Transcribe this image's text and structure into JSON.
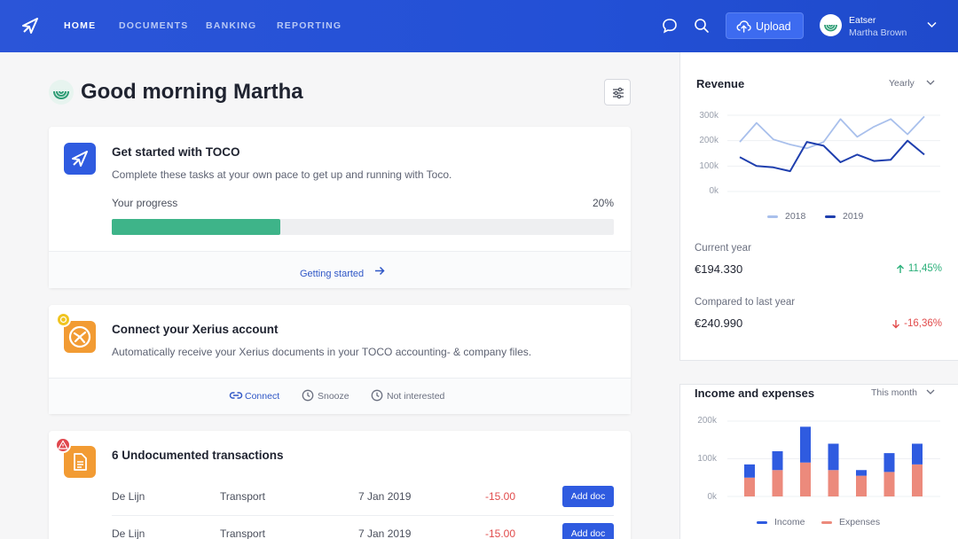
{
  "topbar": {
    "nav": [
      {
        "label": "HOME",
        "active": true
      },
      {
        "label": "DOCUMENTS",
        "active": false
      },
      {
        "label": "BANKING",
        "active": false
      },
      {
        "label": "REPORTING",
        "active": false
      }
    ],
    "upload_label": "Upload",
    "user": {
      "company": "Eatser",
      "name": "Martha Brown"
    },
    "icons": [
      "app-logo-icon",
      "chat-icon",
      "search-icon",
      "upload-cloud-icon",
      "chevron-down-icon"
    ]
  },
  "main": {
    "greeting": "Good morning Martha",
    "get_started": {
      "title": "Get started with TOCO",
      "description": "Complete these tasks at your own pace to get up and running with Toco.",
      "progress_label": "Your progress",
      "progress_value": "20%",
      "progress": 0.335,
      "link": "Getting started"
    },
    "xerius": {
      "title": "Connect your Xerius account",
      "description": "Automatically receive your Xerius documents in your TOCO accounting- & company files.",
      "actions": {
        "connect": "Connect",
        "snooze": "Snooze",
        "not_interested": "Not interested"
      }
    },
    "transactions": {
      "title": "6 Undocumented transactions",
      "button_label": "Add doc",
      "rows": [
        {
          "payee": "De Lijn",
          "category": "Transport",
          "date": "7 Jan 2019",
          "amount": "-15.00"
        },
        {
          "payee": "De Lijn",
          "category": "Transport",
          "date": "7 Jan 2019",
          "amount": "-15.00"
        }
      ]
    }
  },
  "revenue": {
    "title": "Revenue",
    "period": "Yearly",
    "current_year_label": "Current year",
    "current_year_value": "€194.330",
    "current_change": "11,45%",
    "compared_label": "Compared to last year",
    "compared_value": "€240.990",
    "compared_change": "-16,36%"
  },
  "income_expenses": {
    "title": "Income and expenses",
    "period": "This month"
  },
  "colors": {
    "brand_blue": "#2350d6",
    "progress_green": "#3eb489",
    "positive": "#2bb07a",
    "negative": "#e14b4b",
    "series_2018": "#a9c0ec",
    "series_2019": "#1f3fae",
    "income": "#2f5be0",
    "expenses": "#ec8a7c"
  },
  "chart_data": [
    {
      "type": "line",
      "title": "Revenue",
      "y_ticks": [
        "300k",
        "200k",
        "100k",
        "0k"
      ],
      "ylim": [
        0,
        300000
      ],
      "x": [
        1,
        2,
        3,
        4,
        5,
        6,
        7,
        8,
        9,
        10,
        11,
        12
      ],
      "series": [
        {
          "name": "2018",
          "values": [
            195000,
            270000,
            205000,
            185000,
            170000,
            195000,
            285000,
            215000,
            255000,
            285000,
            225000,
            295000
          ]
        },
        {
          "name": "2019",
          "values": [
            135000,
            100000,
            95000,
            80000,
            195000,
            180000,
            115000,
            145000,
            120000,
            125000,
            200000,
            145000
          ]
        }
      ],
      "legend": "bottom"
    },
    {
      "type": "bar",
      "title": "Income and expenses",
      "y_ticks": [
        "200k",
        "100k",
        "0k"
      ],
      "ylim": [
        0,
        200000
      ],
      "categories": [
        "1",
        "2",
        "3",
        "4",
        "5",
        "6",
        "7"
      ],
      "series": [
        {
          "name": "Income",
          "values": [
            85000,
            120000,
            185000,
            140000,
            70000,
            115000,
            140000
          ]
        },
        {
          "name": "Expenses",
          "values": [
            50000,
            70000,
            90000,
            70000,
            55000,
            65000,
            85000
          ]
        }
      ],
      "legend": "bottom"
    }
  ]
}
